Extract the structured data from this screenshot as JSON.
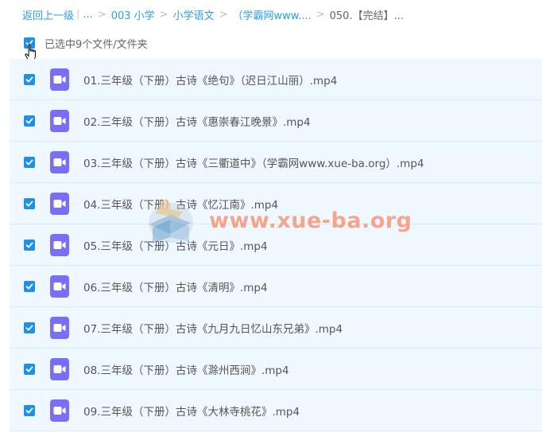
{
  "breadcrumb": {
    "back": "返回上一级",
    "pipe": "|",
    "ellipsis": "...",
    "sep": ">",
    "items": [
      "003 小学",
      "小学语文",
      "（学霸网www....",
      "050.【完结】..."
    ]
  },
  "selection": {
    "text": "已选中9个文件/文件夹"
  },
  "files": [
    "01.三年级（下册）古诗《绝句》（迟日江山丽）.mp4",
    "02.三年级（下册）古诗《惠崇春江晚景》.mp4",
    "03.三年级（下册）古诗《三衢道中》（学霸网www.xue-ba.org）.mp4",
    "04.三年级（下册）古诗《忆江南》.mp4",
    "05.三年级（下册）古诗《元日》.mp4",
    "06.三年级（下册）古诗《清明》.mp4",
    "07.三年级（下册）古诗《九月九日忆山东兄弟》.mp4",
    "08.三年级（下册）古诗《滁州西涧》.mp4",
    "09.三年级（下册）古诗《大林寺桃花》.mp4"
  ],
  "watermark": {
    "text": "www.xue-ba.org"
  },
  "colors": {
    "link": "#2a9de8",
    "checkbox": "#1e90e8",
    "row_bg": "#f0f8ff",
    "video_icon": "#7b6ef6"
  },
  "icons": {
    "file": "video-file-icon",
    "check": "checkbox-checked-icon"
  }
}
